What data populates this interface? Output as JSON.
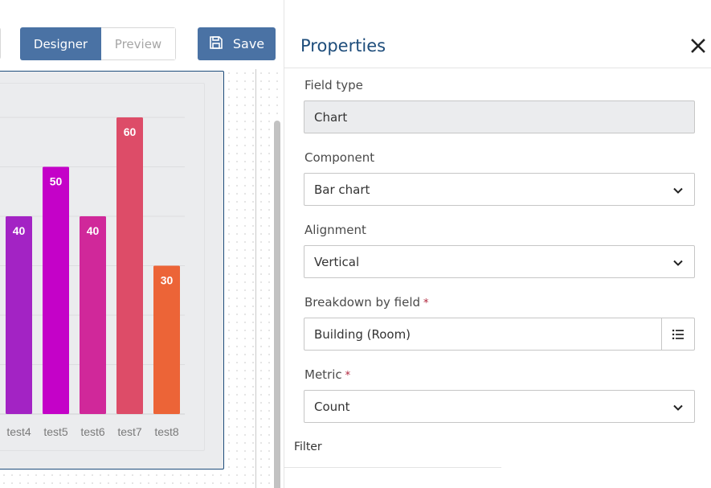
{
  "toolbar": {
    "designer_label": "Designer",
    "preview_label": "Preview",
    "save_label": "Save",
    "active_mode": "Designer"
  },
  "chart_data": {
    "type": "bar",
    "title": "",
    "xlabel": "",
    "ylabel": "",
    "categories": [
      "test4",
      "test5",
      "test6",
      "test7",
      "test8"
    ],
    "values": [
      40,
      50,
      40,
      60,
      30
    ],
    "colors": [
      "#a323c4",
      "#c402c8",
      "#d0289a",
      "#dd4c68",
      "#ec6437"
    ],
    "ylim": [
      0,
      60
    ],
    "gridline_values": [
      0,
      10,
      20,
      30,
      40,
      50,
      60
    ],
    "grid": true,
    "data_labels": true,
    "legend": "none"
  },
  "properties": {
    "title": "Properties",
    "fields": {
      "field_type": {
        "label": "Field type",
        "value": "Chart",
        "readonly": true
      },
      "component": {
        "label": "Component",
        "value": "Bar chart"
      },
      "alignment": {
        "label": "Alignment",
        "value": "Vertical"
      },
      "breakdown": {
        "label": "Breakdown by field",
        "required_mark": "*",
        "value": "Building (Room)"
      },
      "metric": {
        "label": "Metric",
        "required_mark": "*",
        "value": "Count"
      }
    },
    "filter_label": "Filter"
  }
}
